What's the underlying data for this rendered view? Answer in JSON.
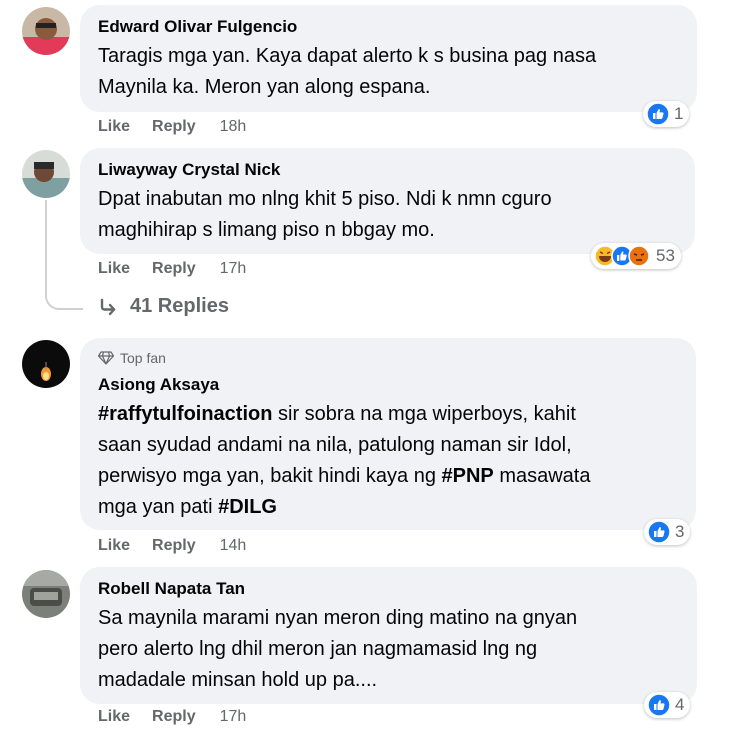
{
  "comments": [
    {
      "author": "Edward Olivar Fulgencio",
      "lines": [
        "Taragis mga yan. Kaya dapat alerto k s busina pag nasa",
        "Maynila ka. Meron yan along espana."
      ],
      "like": "Like",
      "reply": "Reply",
      "time": "18h",
      "reaction_count": "1"
    },
    {
      "author": "Liwayway Crystal Nick",
      "lines": [
        "Dpat inabutan mo nlng khit 5 piso. Ndi k nmn cguro",
        "maghihirap s limang piso n bbgay mo."
      ],
      "like": "Like",
      "reply": "Reply",
      "time": "17h",
      "reaction_count": "53",
      "replies_label": "41 Replies"
    },
    {
      "badge": "Top fan",
      "author": "Asiong Aksaya",
      "line1_bold": "#raffytulfoinaction",
      "line1_rest": " sir sobra na mga wiperboys, kahit",
      "line2": "saan syudad andami na nila, patulong naman sir Idol,",
      "line3_start": "perwisyo mga yan, bakit hindi kaya ng ",
      "line3_bold": "#PNP",
      "line3_end": " masawata",
      "line4_start": "mga yan pati ",
      "line4_bold": "#DILG",
      "like": "Like",
      "reply": "Reply",
      "time": "14h",
      "reaction_count": "3"
    },
    {
      "author": "Robell Napata Tan",
      "lines": [
        "Sa maynila marami nyan meron ding matino na gnyan",
        "pero alerto lng dhil meron jan nagmamasid lng ng",
        "madadale minsan hold up pa...."
      ],
      "like": "Like",
      "reply": "Reply",
      "time": "17h",
      "reaction_count": "4"
    }
  ],
  "colors": {
    "bubble": "#f0f2f5",
    "meta": "#65676b",
    "like_blue": "#1877f2"
  }
}
